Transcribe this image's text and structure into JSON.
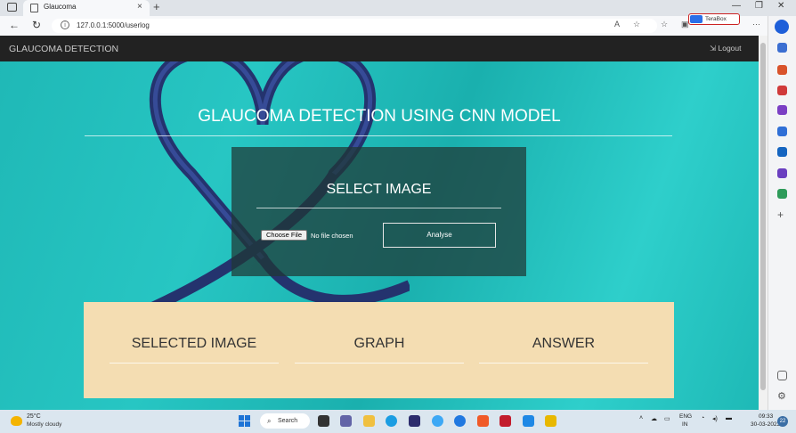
{
  "browser": {
    "tab_title": "Glaucoma",
    "tab_close": "×",
    "new_tab": "+",
    "url": "127.0.0.1:5000/userlog",
    "terabox_label": "TeraBox",
    "window_controls": [
      "—",
      "❐",
      "✕"
    ]
  },
  "navbar": {
    "brand": "GLAUCOMA DETECTION",
    "logout": "⇲ Logout"
  },
  "main": {
    "title": "GLAUCOMA DETECTION USING CNN MODEL",
    "panel_title": "SELECT IMAGE",
    "file_button": "Choose File",
    "file_status": "No file chosen",
    "analyse": "Analyse"
  },
  "results": {
    "columns": [
      "SELECTED IMAGE",
      "GRAPH",
      "ANSWER"
    ]
  },
  "taskbar": {
    "temperature": "25°C",
    "weather": "Mostly cloudy",
    "search": "Search",
    "lang_top": "ENG",
    "lang_bottom": "IN",
    "time": "09:33",
    "date": "30-03-2023",
    "notifications": "22"
  },
  "colors": {
    "navbar": "#222222",
    "results_bg": "#f4ddb2",
    "page_teal": "#27c6c3",
    "stethoscope": "#2a3a78"
  }
}
